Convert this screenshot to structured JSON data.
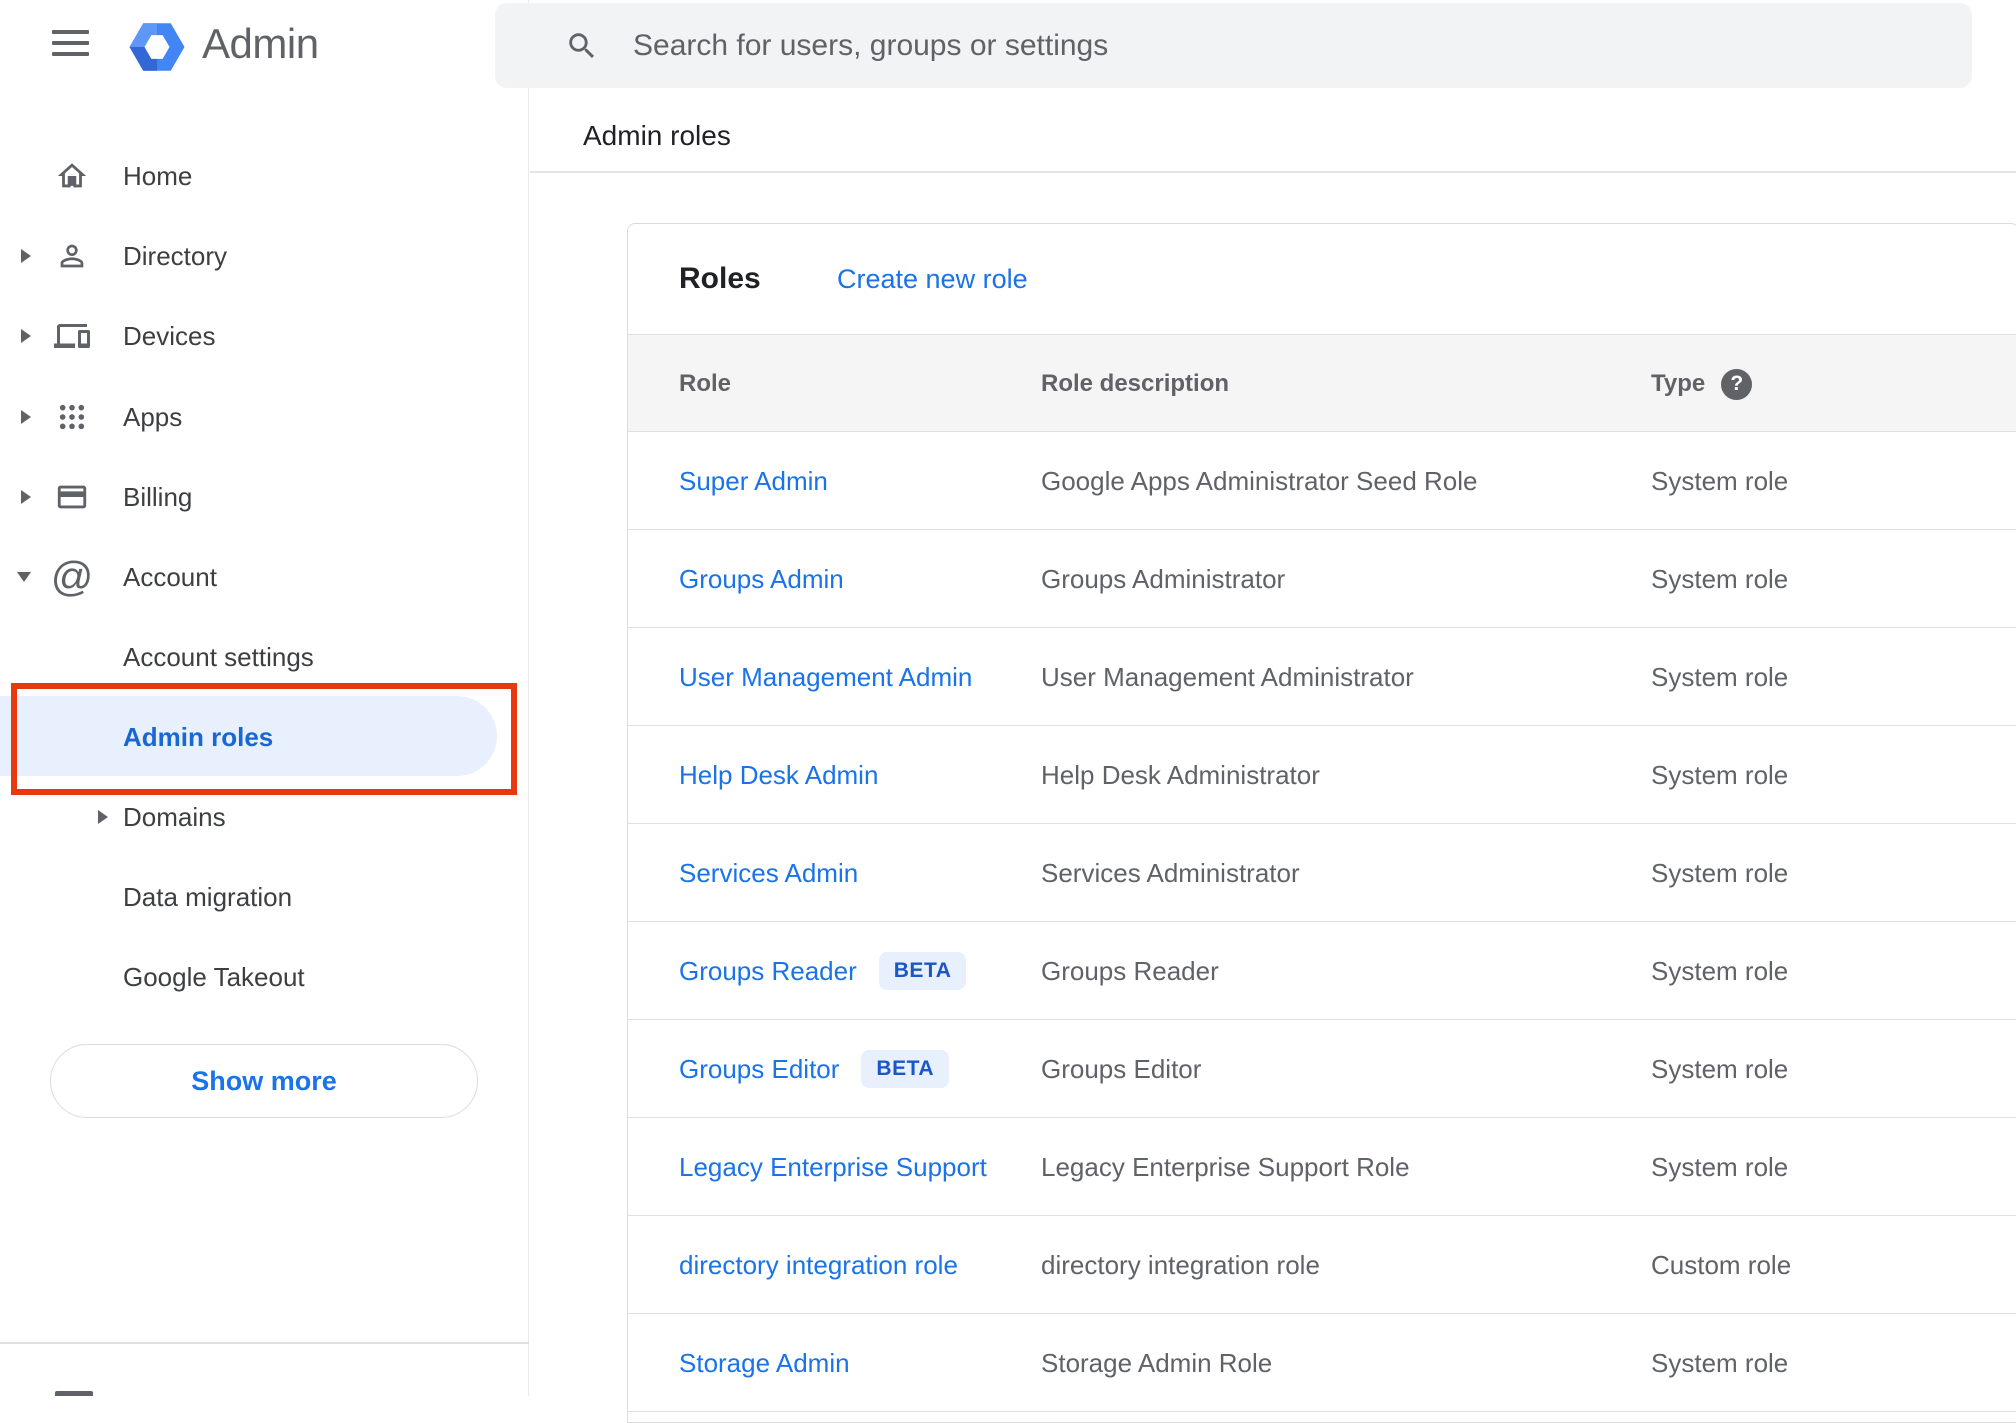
{
  "app": {
    "title": "Admin"
  },
  "search": {
    "placeholder": "Search for users, groups or settings"
  },
  "breadcrumb": "Admin roles",
  "sidebar": {
    "items": [
      {
        "label": "Home",
        "icon": "home",
        "expandable": false,
        "sub": false,
        "selected": false
      },
      {
        "label": "Directory",
        "icon": "person",
        "expandable": true,
        "sub": false,
        "selected": false
      },
      {
        "label": "Devices",
        "icon": "devices",
        "expandable": true,
        "sub": false,
        "selected": false
      },
      {
        "label": "Apps",
        "icon": "apps",
        "expandable": true,
        "sub": false,
        "selected": false
      },
      {
        "label": "Billing",
        "icon": "credit-card",
        "expandable": true,
        "sub": false,
        "selected": false
      },
      {
        "label": "Account",
        "icon": "at-sign",
        "expandable": true,
        "expanded": true,
        "sub": false,
        "selected": false
      },
      {
        "label": "Account settings",
        "icon": null,
        "expandable": false,
        "sub": true,
        "selected": false
      },
      {
        "label": "Admin roles",
        "icon": null,
        "expandable": false,
        "sub": true,
        "selected": true
      },
      {
        "label": "Domains",
        "icon": null,
        "expandable": true,
        "sub": true,
        "selected": false
      },
      {
        "label": "Data migration",
        "icon": null,
        "expandable": false,
        "sub": true,
        "selected": false
      },
      {
        "label": "Google Takeout",
        "icon": null,
        "expandable": false,
        "sub": true,
        "selected": false
      }
    ],
    "show_more_label": "Show more"
  },
  "main": {
    "card_title": "Roles",
    "create_link": "Create new role",
    "table": {
      "columns": [
        "Role",
        "Role description",
        "Type"
      ],
      "type_help_icon": "help-icon",
      "rows": [
        {
          "role": "Super Admin",
          "badge": null,
          "description": "Google Apps Administrator Seed Role",
          "type": "System role"
        },
        {
          "role": "Groups Admin",
          "badge": null,
          "description": "Groups Administrator",
          "type": "System role"
        },
        {
          "role": "User Management Admin",
          "badge": null,
          "description": "User Management Administrator",
          "type": "System role"
        },
        {
          "role": "Help Desk Admin",
          "badge": null,
          "description": "Help Desk Administrator",
          "type": "System role"
        },
        {
          "role": "Services Admin",
          "badge": null,
          "description": "Services Administrator",
          "type": "System role"
        },
        {
          "role": "Groups Reader",
          "badge": "BETA",
          "description": "Groups Reader",
          "type": "System role"
        },
        {
          "role": "Groups Editor",
          "badge": "BETA",
          "description": "Groups Editor",
          "type": "System role"
        },
        {
          "role": "Legacy Enterprise Support",
          "badge": null,
          "description": "Legacy Enterprise Support Role",
          "type": "System role"
        },
        {
          "role": "directory integration role",
          "badge": null,
          "description": "directory integration role",
          "type": "Custom role"
        },
        {
          "role": "Storage Admin",
          "badge": null,
          "description": "Storage Admin Role",
          "type": "System role"
        }
      ]
    }
  },
  "colors": {
    "link_blue": "#1a73e8",
    "selected_blue": "#1967d2",
    "selected_pill_bg": "#e8f0fe",
    "annotation_red": "#e8380d",
    "icon_gray": "#5f6368",
    "header_row_bg": "#f5f5f5",
    "divider": "#e0e0e0",
    "logo_blue": "#4285f4"
  }
}
